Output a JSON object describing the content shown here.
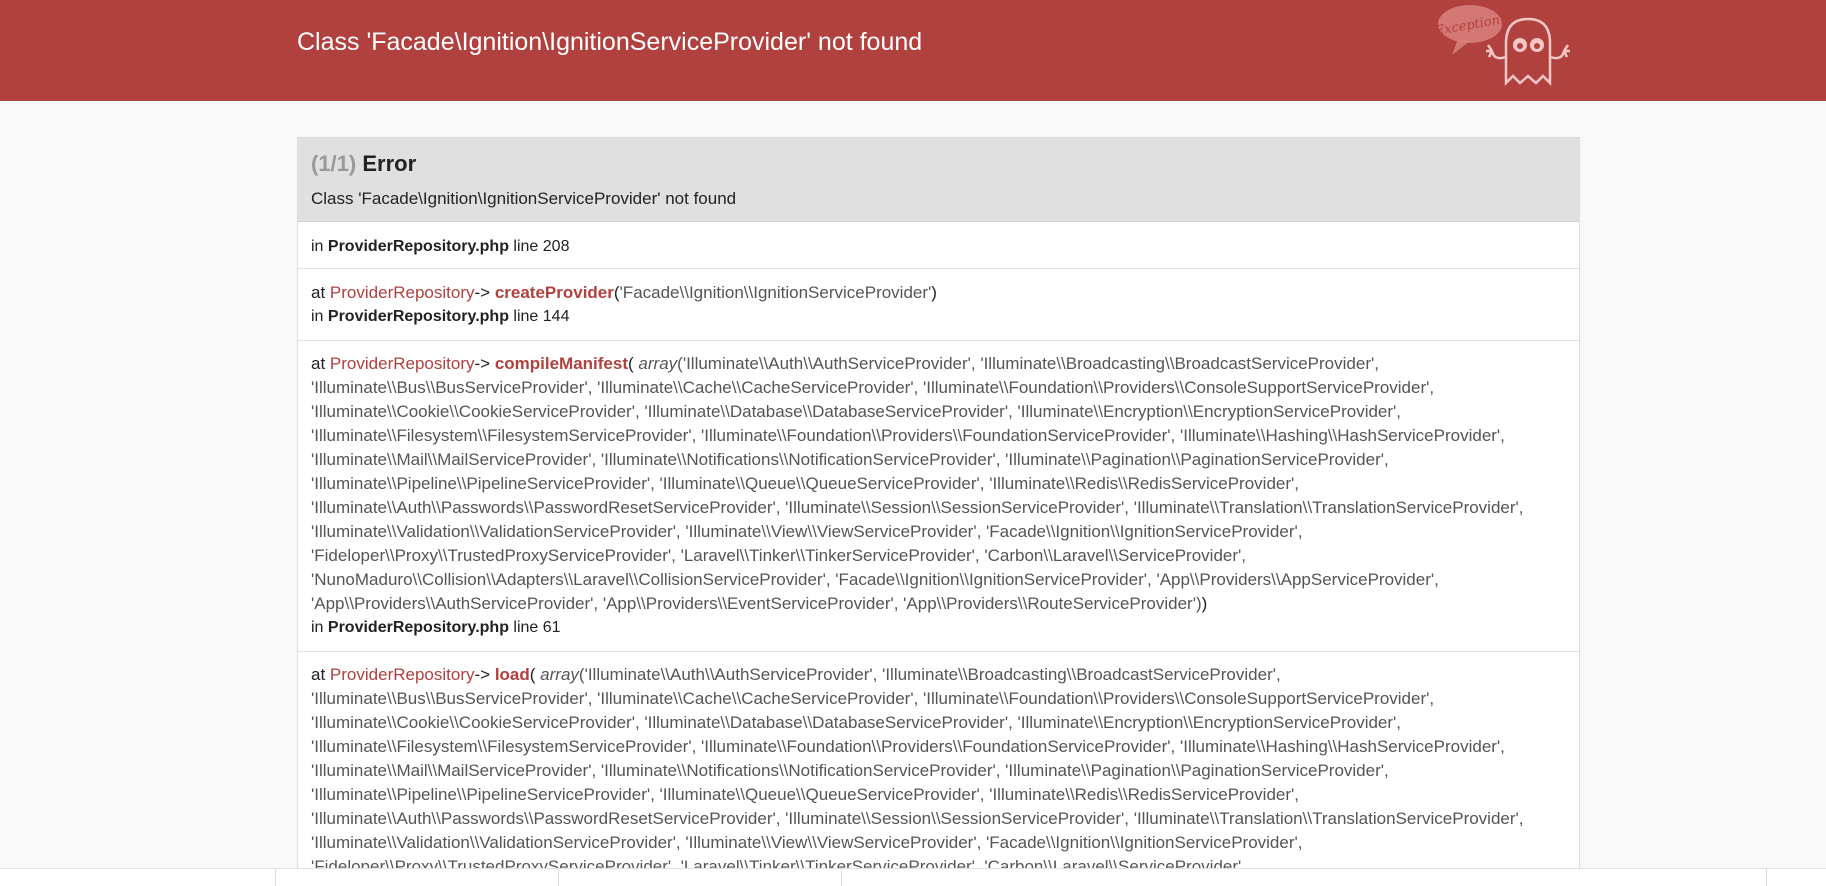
{
  "header": {
    "title": "Class 'Facade\\Ignition\\IgnitionServiceProvider' not found",
    "logo_text": "Exception!"
  },
  "panel": {
    "count": "(1/1)",
    "label": "Error",
    "message": "Class 'Facade\\Ignition\\IgnitionServiceProvider' not found"
  },
  "trace": {
    "first_location": {
      "prefix": "in",
      "file": "ProviderRepository.php",
      "line": "line 208"
    },
    "items": [
      {
        "at": "at",
        "class": "ProviderRepository",
        "arrow": "->",
        "method": "createProvider",
        "open": "(",
        "args": "'Facade\\\\Ignition\\\\IgnitionServiceProvider'",
        "close": ")",
        "location": {
          "prefix": "in",
          "file": "ProviderRepository.php",
          "line": "line 144"
        }
      },
      {
        "at": "at",
        "class": "ProviderRepository",
        "arrow": "->",
        "method": "compileManifest",
        "open": "(",
        "keyword": "array",
        "args": "('Illuminate\\\\Auth\\\\AuthServiceProvider', 'Illuminate\\\\Broadcasting\\\\BroadcastServiceProvider', 'Illuminate\\\\Bus\\\\BusServiceProvider', 'Illuminate\\\\Cache\\\\CacheServiceProvider', 'Illuminate\\\\Foundation\\\\Providers\\\\ConsoleSupportServiceProvider', 'Illuminate\\\\Cookie\\\\CookieServiceProvider', 'Illuminate\\\\Database\\\\DatabaseServiceProvider', 'Illuminate\\\\Encryption\\\\EncryptionServiceProvider', 'Illuminate\\\\Filesystem\\\\FilesystemServiceProvider', 'Illuminate\\\\Foundation\\\\Providers\\\\FoundationServiceProvider', 'Illuminate\\\\Hashing\\\\HashServiceProvider', 'Illuminate\\\\Mail\\\\MailServiceProvider', 'Illuminate\\\\Notifications\\\\NotificationServiceProvider', 'Illuminate\\\\Pagination\\\\PaginationServiceProvider', 'Illuminate\\\\Pipeline\\\\PipelineServiceProvider', 'Illuminate\\\\Queue\\\\QueueServiceProvider', 'Illuminate\\\\Redis\\\\RedisServiceProvider', 'Illuminate\\\\Auth\\\\Passwords\\\\PasswordResetServiceProvider', 'Illuminate\\\\Session\\\\SessionServiceProvider', 'Illuminate\\\\Translation\\\\TranslationServiceProvider', 'Illuminate\\\\Validation\\\\ValidationServiceProvider', 'Illuminate\\\\View\\\\ViewServiceProvider', 'Facade\\\\Ignition\\\\IgnitionServiceProvider', 'Fideloper\\\\Proxy\\\\TrustedProxyServiceProvider', 'Laravel\\\\Tinker\\\\TinkerServiceProvider', 'Carbon\\\\Laravel\\\\ServiceProvider', 'NunoMaduro\\\\Collision\\\\Adapters\\\\Laravel\\\\CollisionServiceProvider', 'Facade\\\\Ignition\\\\IgnitionServiceProvider', 'App\\\\Providers\\\\AppServiceProvider', 'App\\\\Providers\\\\AuthServiceProvider', 'App\\\\Providers\\\\EventServiceProvider', 'App\\\\Providers\\\\RouteServiceProvider')",
        "close": ")",
        "location": {
          "prefix": "in",
          "file": "ProviderRepository.php",
          "line": "line 61"
        }
      },
      {
        "at": "at",
        "class": "ProviderRepository",
        "arrow": "->",
        "method": "load",
        "open": "(",
        "keyword": "array",
        "args": "('Illuminate\\\\Auth\\\\AuthServiceProvider', 'Illuminate\\\\Broadcasting\\\\BroadcastServiceProvider', 'Illuminate\\\\Bus\\\\BusServiceProvider', 'Illuminate\\\\Cache\\\\CacheServiceProvider', 'Illuminate\\\\Foundation\\\\Providers\\\\ConsoleSupportServiceProvider', 'Illuminate\\\\Cookie\\\\CookieServiceProvider', 'Illuminate\\\\Database\\\\DatabaseServiceProvider', 'Illuminate\\\\Encryption\\\\EncryptionServiceProvider', 'Illuminate\\\\Filesystem\\\\FilesystemServiceProvider', 'Illuminate\\\\Foundation\\\\Providers\\\\FoundationServiceProvider', 'Illuminate\\\\Hashing\\\\HashServiceProvider', 'Illuminate\\\\Mail\\\\MailServiceProvider', 'Illuminate\\\\Notifications\\\\NotificationServiceProvider', 'Illuminate\\\\Pagination\\\\PaginationServiceProvider', 'Illuminate\\\\Pipeline\\\\PipelineServiceProvider', 'Illuminate\\\\Queue\\\\QueueServiceProvider', 'Illuminate\\\\Redis\\\\RedisServiceProvider', 'Illuminate\\\\Auth\\\\Passwords\\\\PasswordResetServiceProvider', 'Illuminate\\\\Session\\\\SessionServiceProvider', 'Illuminate\\\\Translation\\\\TranslationServiceProvider', 'Illuminate\\\\Validation\\\\ValidationServiceProvider', 'Illuminate\\\\View\\\\ViewServiceProvider', 'Facade\\\\Ignition\\\\IgnitionServiceProvider', 'Fideloper\\\\Proxy\\\\TrustedProxyServiceProvider', 'Laravel\\\\Tinker\\\\TinkerServiceProvider', 'Carbon\\\\Laravel\\\\ServiceProvider',"
      }
    ]
  },
  "colors": {
    "header_bg": "#b0413e",
    "accent": "#b0413e",
    "page_bg": "#f8f8f8",
    "panel_header_bg": "#e0e0e0"
  }
}
